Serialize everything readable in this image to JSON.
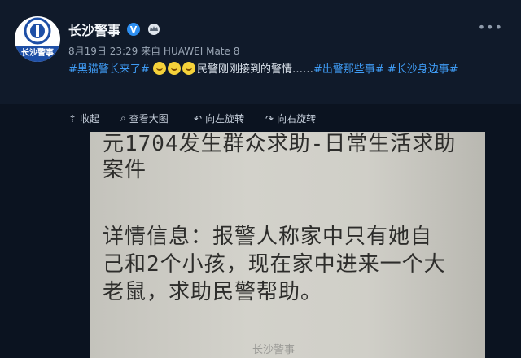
{
  "post": {
    "username": "长沙警事",
    "avatar_text": "长沙警事",
    "meta": "8月19日 23:29 来自 HUAWEI Mate 8",
    "hashtag1": "#黑猫警长来了#",
    "emoji_count": 3,
    "text_middle": "民警刚刚接到的警情……",
    "hashtag2": "#出警那些事#",
    "hashtag3": "#长沙身边事#"
  },
  "toolbar": {
    "collapse": "收起",
    "view_large": "查看大图",
    "rotate_left": "向左旋转",
    "rotate_right": "向右旋转"
  },
  "photo": {
    "line1": "元1704发生群众求助-日常生活求助",
    "line2": "案件",
    "line3": "详情信息：报警人称家中只有她自",
    "line4": "己和2个小孩，现在家中进来一个大",
    "line5": "老鼠，求助民警帮助。",
    "watermark": "长沙警事"
  },
  "colors": {
    "tag": "#3f9cf5",
    "verified": "#2d8ef0",
    "background": "#0c1422"
  },
  "icons": [
    "shield-logo-icon",
    "verified-icon",
    "crown-icon",
    "more-icon",
    "collapse-icon",
    "magnify-icon",
    "rotate-left-icon",
    "rotate-right-icon"
  ]
}
